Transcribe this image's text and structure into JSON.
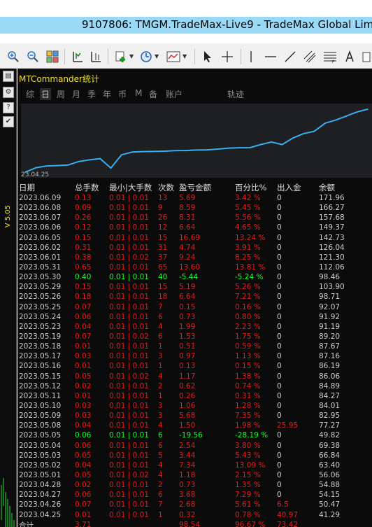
{
  "window": {
    "title": "9107806: TMGM.TradeMax-Live9 - TradeMax Global Limit"
  },
  "left_toolbar": {
    "version_label": "V 5.05"
  },
  "panel": {
    "title": "MTCommander统计",
    "tabs": [
      "综",
      "日",
      "周",
      "月",
      "季",
      "年",
      "币",
      "M",
      "备",
      "账户",
      "轨迹"
    ],
    "active_tab": "日"
  },
  "chart_data": {
    "type": "line",
    "x": [
      "2023.04.25",
      "2023.04.26",
      "2023.04.27",
      "2023.04.28",
      "2023.05.01",
      "2023.05.02",
      "2023.05.03",
      "2023.05.04",
      "2023.05.05",
      "2023.05.08",
      "2023.05.09",
      "2023.05.10",
      "2023.05.11",
      "2023.05.12",
      "2023.05.15",
      "2023.05.16",
      "2023.05.17",
      "2023.05.18",
      "2023.05.19",
      "2023.05.22",
      "2023.05.23",
      "2023.05.24",
      "2023.05.25",
      "2023.05.26",
      "2023.05.29",
      "2023.05.30",
      "2023.05.31",
      "2023.06.01",
      "2023.06.02",
      "2023.06.05",
      "2023.06.06",
      "2023.06.07",
      "2023.06.08",
      "2023.06.09"
    ],
    "values": [
      41.29,
      50.47,
      54.15,
      54.88,
      56.06,
      63.4,
      66.84,
      69.38,
      49.82,
      77.27,
      82.95,
      84.01,
      84.27,
      84.89,
      86.06,
      86.19,
      87.16,
      87.67,
      89.2,
      91.19,
      91.92,
      92.07,
      98.71,
      103.9,
      98.46,
      112.06,
      121.3,
      126.04,
      142.73,
      149.37,
      157.68,
      166.27,
      171.96
    ],
    "x_tick_label": "23.04.25",
    "grid": false
  },
  "table": {
    "headers": [
      "日期",
      "总手数",
      "最小|大手数",
      "次数",
      "盈亏金额",
      "百分比%",
      "出入金",
      "余额"
    ],
    "rows": [
      {
        "date": "2023.06.09",
        "lots": "0.13",
        "minmax": "0.01 | 0.01",
        "count": "13",
        "pnl": "5.69",
        "pct": "3.42 %",
        "flow": "0",
        "balance": "171.96",
        "color": "red"
      },
      {
        "date": "2023.06.08",
        "lots": "0.09",
        "minmax": "0.01 | 0.01",
        "count": "9",
        "pnl": "8.59",
        "pct": "5.45 %",
        "flow": "0",
        "balance": "166.27",
        "color": "red"
      },
      {
        "date": "2023.06.07",
        "lots": "0.26",
        "minmax": "0.01 | 0.01",
        "count": "26",
        "pnl": "8.31",
        "pct": "5.56 %",
        "flow": "0",
        "balance": "157.68",
        "color": "red"
      },
      {
        "date": "2023.06.06",
        "lots": "0.12",
        "minmax": "0.01 | 0.01",
        "count": "12",
        "pnl": "6.64",
        "pct": "4.65 %",
        "flow": "0",
        "balance": "149.37",
        "color": "red"
      },
      {
        "date": "2023.06.05",
        "lots": "0.15",
        "minmax": "0.01 | 0.01",
        "count": "15",
        "pnl": "16.69",
        "pct": "13.24 %",
        "flow": "0",
        "balance": "142.73",
        "color": "red"
      },
      {
        "date": "2023.06.02",
        "lots": "0.31",
        "minmax": "0.01 | 0.01",
        "count": "31",
        "pnl": "4.74",
        "pct": "3.91 %",
        "flow": "0",
        "balance": "126.04",
        "color": "red"
      },
      {
        "date": "2023.06.01",
        "lots": "0.38",
        "minmax": "0.01 | 0.02",
        "count": "37",
        "pnl": "9.24",
        "pct": "8.25 %",
        "flow": "0",
        "balance": "121.30",
        "color": "red"
      },
      {
        "date": "2023.05.31",
        "lots": "0.65",
        "minmax": "0.01 | 0.01",
        "count": "65",
        "pnl": "13.60",
        "pct": "13.81 %",
        "flow": "0",
        "balance": "112.06",
        "color": "red"
      },
      {
        "date": "2023.05.30",
        "lots": "0.40",
        "minmax": "0.01 | 0.01",
        "count": "40",
        "pnl": "-5.44",
        "pct": "-5.24 %",
        "flow": "0",
        "balance": "98.46",
        "color": "green"
      },
      {
        "date": "2023.05.29",
        "lots": "0.15",
        "minmax": "0.01 | 0.01",
        "count": "15",
        "pnl": "5.19",
        "pct": "5.26 %",
        "flow": "0",
        "balance": "103.90",
        "color": "red"
      },
      {
        "date": "2023.05.26",
        "lots": "0.18",
        "minmax": "0.01 | 0.01",
        "count": "18",
        "pnl": "6.64",
        "pct": "7.21 %",
        "flow": "0",
        "balance": "98.71",
        "color": "red"
      },
      {
        "date": "2023.05.25",
        "lots": "0.07",
        "minmax": "0.01 | 0.01",
        "count": "7",
        "pnl": "0.15",
        "pct": "0.16 %",
        "flow": "0",
        "balance": "92.07",
        "color": "red"
      },
      {
        "date": "2023.05.24",
        "lots": "0.06",
        "minmax": "0.01 | 0.01",
        "count": "6",
        "pnl": "0.73",
        "pct": "0.80 %",
        "flow": "0",
        "balance": "91.92",
        "color": "red"
      },
      {
        "date": "2023.05.23",
        "lots": "0.04",
        "minmax": "0.01 | 0.01",
        "count": "4",
        "pnl": "1.99",
        "pct": "2.23 %",
        "flow": "0",
        "balance": "91.19",
        "color": "red"
      },
      {
        "date": "2023.05.19",
        "lots": "0.07",
        "minmax": "0.01 | 0.02",
        "count": "6",
        "pnl": "1.53",
        "pct": "1.75 %",
        "flow": "0",
        "balance": "89.20",
        "color": "red"
      },
      {
        "date": "2023.05.18",
        "lots": "0.01",
        "minmax": "0.01 | 0.01",
        "count": "1",
        "pnl": "0.51",
        "pct": "0.59 %",
        "flow": "0",
        "balance": "87.67",
        "color": "red"
      },
      {
        "date": "2023.05.17",
        "lots": "0.03",
        "minmax": "0.01 | 0.01",
        "count": "3",
        "pnl": "0.97",
        "pct": "1.13 %",
        "flow": "0",
        "balance": "87.16",
        "color": "red"
      },
      {
        "date": "2023.05.16",
        "lots": "0.01",
        "minmax": "0.01 | 0.01",
        "count": "1",
        "pnl": "0.13",
        "pct": "0.15 %",
        "flow": "0",
        "balance": "86.19",
        "color": "red"
      },
      {
        "date": "2023.05.15",
        "lots": "0.05",
        "minmax": "0.01 | 0.02",
        "count": "4",
        "pnl": "1.17",
        "pct": "1.38 %",
        "flow": "0",
        "balance": "86.06",
        "color": "red"
      },
      {
        "date": "2023.05.12",
        "lots": "0.02",
        "minmax": "0.01 | 0.01",
        "count": "2",
        "pnl": "0.62",
        "pct": "0.74 %",
        "flow": "0",
        "balance": "84.89",
        "color": "red"
      },
      {
        "date": "2023.05.11",
        "lots": "0.01",
        "minmax": "0.01 | 0.01",
        "count": "1",
        "pnl": "0.26",
        "pct": "0.31 %",
        "flow": "0",
        "balance": "84.27",
        "color": "red"
      },
      {
        "date": "2023.05.10",
        "lots": "0.03",
        "minmax": "0.01 | 0.01",
        "count": "3",
        "pnl": "1.06",
        "pct": "1.28 %",
        "flow": "0",
        "balance": "84.01",
        "color": "red"
      },
      {
        "date": "2023.05.09",
        "lots": "0.03",
        "minmax": "0.01 | 0.01",
        "count": "3",
        "pnl": "5.68",
        "pct": "7.35 %",
        "flow": "0",
        "balance": "82.95",
        "color": "red"
      },
      {
        "date": "2023.05.08",
        "lots": "0.04",
        "minmax": "0.01 | 0.01",
        "count": "4",
        "pnl": "1.50",
        "pct": "1.98 %",
        "flow": "25.95",
        "balance": "77.27",
        "color": "red"
      },
      {
        "date": "2023.05.05",
        "lots": "0.06",
        "minmax": "0.01 | 0.01",
        "count": "6",
        "pnl": "-19.56",
        "pct": "-28.19 %",
        "flow": "0",
        "balance": "49.82",
        "color": "green"
      },
      {
        "date": "2023.05.04",
        "lots": "0.06",
        "minmax": "0.01 | 0.01",
        "count": "6",
        "pnl": "2.54",
        "pct": "3.80 %",
        "flow": "0",
        "balance": "69.38",
        "color": "red"
      },
      {
        "date": "2023.05.03",
        "lots": "0.05",
        "minmax": "0.01 | 0.01",
        "count": "5",
        "pnl": "3.44",
        "pct": "5.43 %",
        "flow": "0",
        "balance": "66.84",
        "color": "red"
      },
      {
        "date": "2023.05.02",
        "lots": "0.04",
        "minmax": "0.01 | 0.01",
        "count": "4",
        "pnl": "7.34",
        "pct": "13.09 %",
        "flow": "0",
        "balance": "63.40",
        "color": "red"
      },
      {
        "date": "2023.05.01",
        "lots": "0.05",
        "minmax": "0.01 | 0.02",
        "count": "4",
        "pnl": "1.18",
        "pct": "2.15 %",
        "flow": "0",
        "balance": "56.06",
        "color": "red"
      },
      {
        "date": "2023.04.28",
        "lots": "0.02",
        "minmax": "0.01 | 0.01",
        "count": "2",
        "pnl": "0.73",
        "pct": "1.35 %",
        "flow": "0",
        "balance": "54.88",
        "color": "red"
      },
      {
        "date": "2023.04.27",
        "lots": "0.06",
        "minmax": "0.01 | 0.01",
        "count": "6",
        "pnl": "3.68",
        "pct": "7.29 %",
        "flow": "0",
        "balance": "54.15",
        "color": "red"
      },
      {
        "date": "2023.04.26",
        "lots": "0.07",
        "minmax": "0.01 | 0.01",
        "count": "7",
        "pnl": "2.68",
        "pct": "5.61 %",
        "flow": "6.5",
        "balance": "50.47",
        "color": "red"
      },
      {
        "date": "2023.04.25",
        "lots": "0.01",
        "minmax": "0.01 | 0.01",
        "count": "1",
        "pnl": "0.32",
        "pct": "0.78 %",
        "flow": "40.97",
        "balance": "41.29",
        "color": "red"
      }
    ],
    "total": {
      "label": "合计",
      "lots": "3.71",
      "pnl": "98.54",
      "pct": "96.67 %",
      "flow": "73.42"
    }
  },
  "colors": {
    "positive": "#e21e1e",
    "negative": "#14ff24",
    "chart_line": "#3aaef0",
    "panel_title": "#f4e225",
    "title_bar": "#99d9f5"
  },
  "icons": [
    "zoom-in-icon",
    "zoom-out-icon",
    "tile-windows-icon",
    "autoscroll-icon",
    "chart-shift-icon",
    "new-order-icon",
    "history-clock-icon",
    "templates-icon",
    "cursor-icon",
    "crosshair-icon",
    "vertical-line-icon",
    "horizontal-line-icon",
    "trendline-icon",
    "channel-icon",
    "fibonacci-icon",
    "text-icon"
  ]
}
